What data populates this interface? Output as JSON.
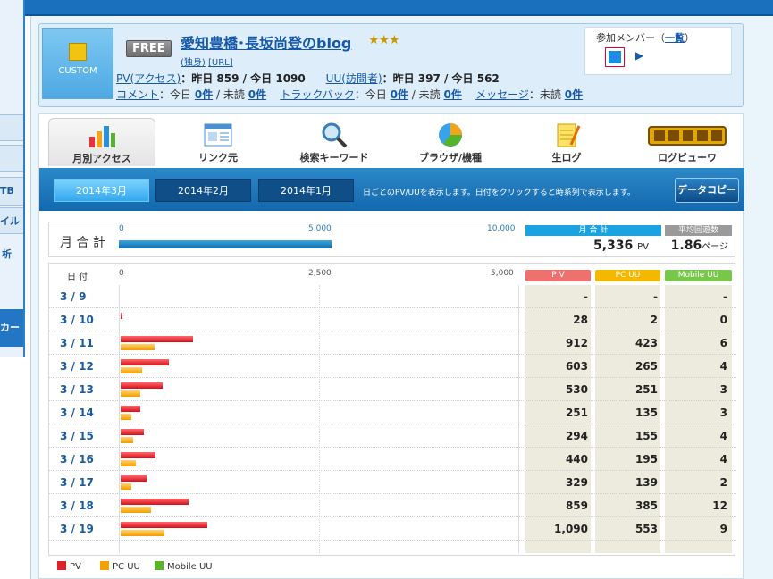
{
  "sidebar": {
    "items": [
      "TB",
      "イル",
      "析",
      "カー"
    ]
  },
  "header": {
    "logo_text": "CUSTOM",
    "plan_badge": "FREE",
    "blog_title": "愛知豊橋･長坂尚登のblog",
    "stars": "★★★",
    "tag_solo": "(独身)",
    "tag_url": "[URL]",
    "pv_label": "PV(アクセス)",
    "pv_text": "：昨日 859 / 今日 1090",
    "uu_label": "UU(訪問者)",
    "uu_text": "：昨日 397 / 今日 562",
    "comment_label": "コメント",
    "comment_text": "：今日",
    "comment_today": "0件",
    "comment_sep": "/ 未読",
    "comment_unread": "0件",
    "trackback_label": "トラックバック",
    "trackback_text": "：今日",
    "trackback_today": "0件",
    "trackback_sep": "/ 未読",
    "trackback_unread": "0件",
    "message_label": "メッセージ",
    "message_text": "：未読",
    "message_unread": "0件",
    "members_label": "参加メンバー（",
    "members_link": "一覧",
    "members_close": "）",
    "members_arrow": "▶"
  },
  "nav": {
    "tabs": [
      "月別アクセス",
      "リンク元",
      "検索キーワード",
      "ブラウザ/機種",
      "生ログ",
      "ログビューワ"
    ]
  },
  "monthbar": {
    "months": [
      "2014年3月",
      "2014年2月",
      "2014年1月"
    ],
    "note": "日ごとのPV/UUを表示します。日付をクリックすると時系列で表示します。",
    "copy_button": "データコピー"
  },
  "monthly": {
    "label": "月 合 計",
    "scale": [
      "0",
      "5,000",
      "10,000"
    ],
    "total_pv": 5336,
    "total_label": "月 合 計",
    "total_value": "5,336",
    "total_unit": "PV",
    "avg_label": "平均回遊数",
    "avg_value": "1.86",
    "avg_unit": "ページ"
  },
  "daily": {
    "date_header": "日 付",
    "scale": [
      "0",
      "2,500",
      "5,000"
    ],
    "col_pv": "P V",
    "col_pc": "PC UU",
    "col_mobile": "Mobile UU",
    "rows": [
      {
        "date": "3 / 9",
        "pv": "-",
        "pc": "-",
        "mobile": "-",
        "pv_n": 0,
        "pc_n": 0
      },
      {
        "date": "3 / 10",
        "pv": "28",
        "pc": "2",
        "mobile": "0",
        "pv_n": 28,
        "pc_n": 2
      },
      {
        "date": "3 / 11",
        "pv": "912",
        "pc": "423",
        "mobile": "6",
        "pv_n": 912,
        "pc_n": 423
      },
      {
        "date": "3 / 12",
        "pv": "603",
        "pc": "265",
        "mobile": "4",
        "pv_n": 603,
        "pc_n": 265
      },
      {
        "date": "3 / 13",
        "pv": "530",
        "pc": "251",
        "mobile": "3",
        "pv_n": 530,
        "pc_n": 251
      },
      {
        "date": "3 / 14",
        "pv": "251",
        "pc": "135",
        "mobile": "3",
        "pv_n": 251,
        "pc_n": 135
      },
      {
        "date": "3 / 15",
        "pv": "294",
        "pc": "155",
        "mobile": "4",
        "pv_n": 294,
        "pc_n": 155
      },
      {
        "date": "3 / 16",
        "pv": "440",
        "pc": "195",
        "mobile": "4",
        "pv_n": 440,
        "pc_n": 195
      },
      {
        "date": "3 / 17",
        "pv": "329",
        "pc": "139",
        "mobile": "2",
        "pv_n": 329,
        "pc_n": 139
      },
      {
        "date": "3 / 18",
        "pv": "859",
        "pc": "385",
        "mobile": "12",
        "pv_n": 859,
        "pc_n": 385
      },
      {
        "date": "3 / 19",
        "pv": "1,090",
        "pc": "553",
        "mobile": "9",
        "pv_n": 1090,
        "pc_n": 553
      }
    ]
  },
  "legend": {
    "pv": "PV",
    "pc": "PC UU",
    "mobile": "Mobile UU"
  },
  "colors": {
    "pv": "#e0202c",
    "pc": "#f5a200",
    "mobile": "#58b52a",
    "sum_header": "#1aa3e0",
    "avg_header": "#9a9a9a"
  }
}
